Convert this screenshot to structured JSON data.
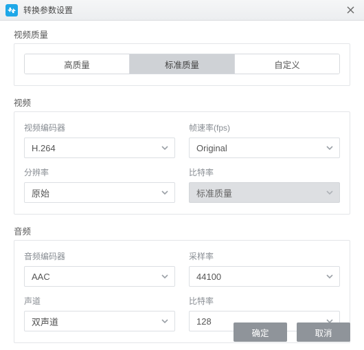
{
  "window": {
    "title": "转换参数设置"
  },
  "sections": {
    "videoQuality": {
      "title": "视频质量",
      "options": {
        "high": "高质量",
        "standard": "标准质量",
        "custom": "自定义"
      },
      "active": "standard"
    },
    "video": {
      "title": "视频",
      "encoder": {
        "label": "视频编码器",
        "value": "H.264"
      },
      "fps": {
        "label": "帧速率(fps)",
        "value": "Original"
      },
      "resolution": {
        "label": "分辨率",
        "value": "原始"
      },
      "bitrate": {
        "label": "比特率",
        "value": "标准质量"
      }
    },
    "audio": {
      "title": "音频",
      "encoder": {
        "label": "音频编码器",
        "value": "AAC"
      },
      "sampleRate": {
        "label": "采样率",
        "value": "44100"
      },
      "channels": {
        "label": "声道",
        "value": "双声道"
      },
      "bitrate": {
        "label": "比特率",
        "value": "128"
      }
    }
  },
  "footer": {
    "ok": "确定",
    "cancel": "取消"
  }
}
